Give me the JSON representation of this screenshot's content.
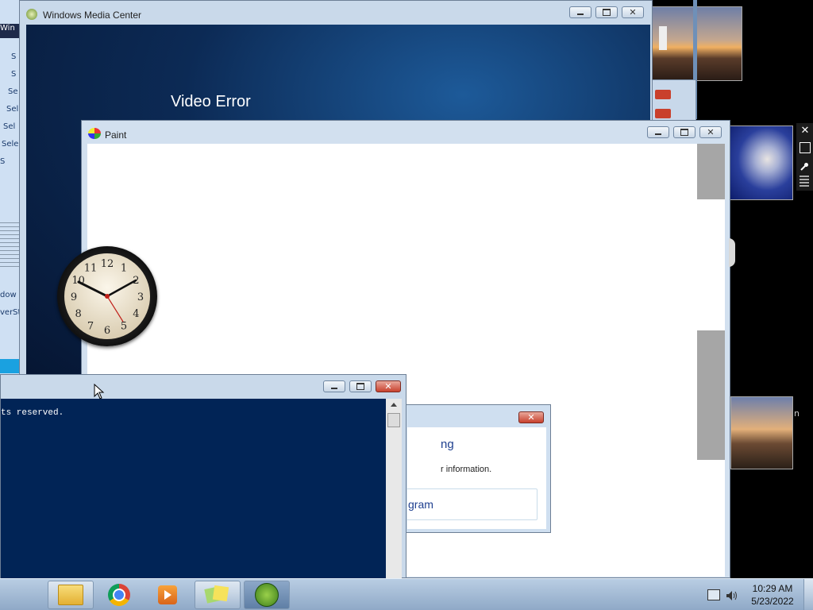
{
  "media_center": {
    "title": "Windows Media Center",
    "heading": "Video Error"
  },
  "paint": {
    "title": "Paint"
  },
  "powershell": {
    "copyright_fragment": "ts reserved."
  },
  "dialog": {
    "heading_fragment": "ng",
    "info_fragment": "r information.",
    "button_fragment": "gram"
  },
  "left_strip": {
    "items": [
      "Win",
      "S",
      "S",
      "Se",
      "Sel",
      "Sel",
      "Sele",
      "S",
      "S",
      "S",
      "dow",
      "verSt"
    ]
  },
  "gadget_toolbar": {
    "close": "✕",
    "options": "options-icon",
    "wrench": "wrench-icon",
    "grip": "grip-icon"
  },
  "right_gadget_fragment": "n",
  "taskbar": {
    "buttons": [
      "file-explorer-icon",
      "chrome-icon",
      "media-player-icon",
      "sticky-notes-icon",
      "media-center-icon"
    ],
    "time": "10:29 AM",
    "date": "5/23/2022"
  },
  "clock_gadget": {
    "numbers": [
      "12",
      "1",
      "2",
      "3",
      "4",
      "5",
      "6",
      "7",
      "8",
      "9",
      "10",
      "11"
    ],
    "time": "10:09"
  },
  "colors": {
    "media_center_bg": "#0c2a55",
    "powershell_bg": "#012456",
    "taskbar": "#a9c1dc"
  }
}
